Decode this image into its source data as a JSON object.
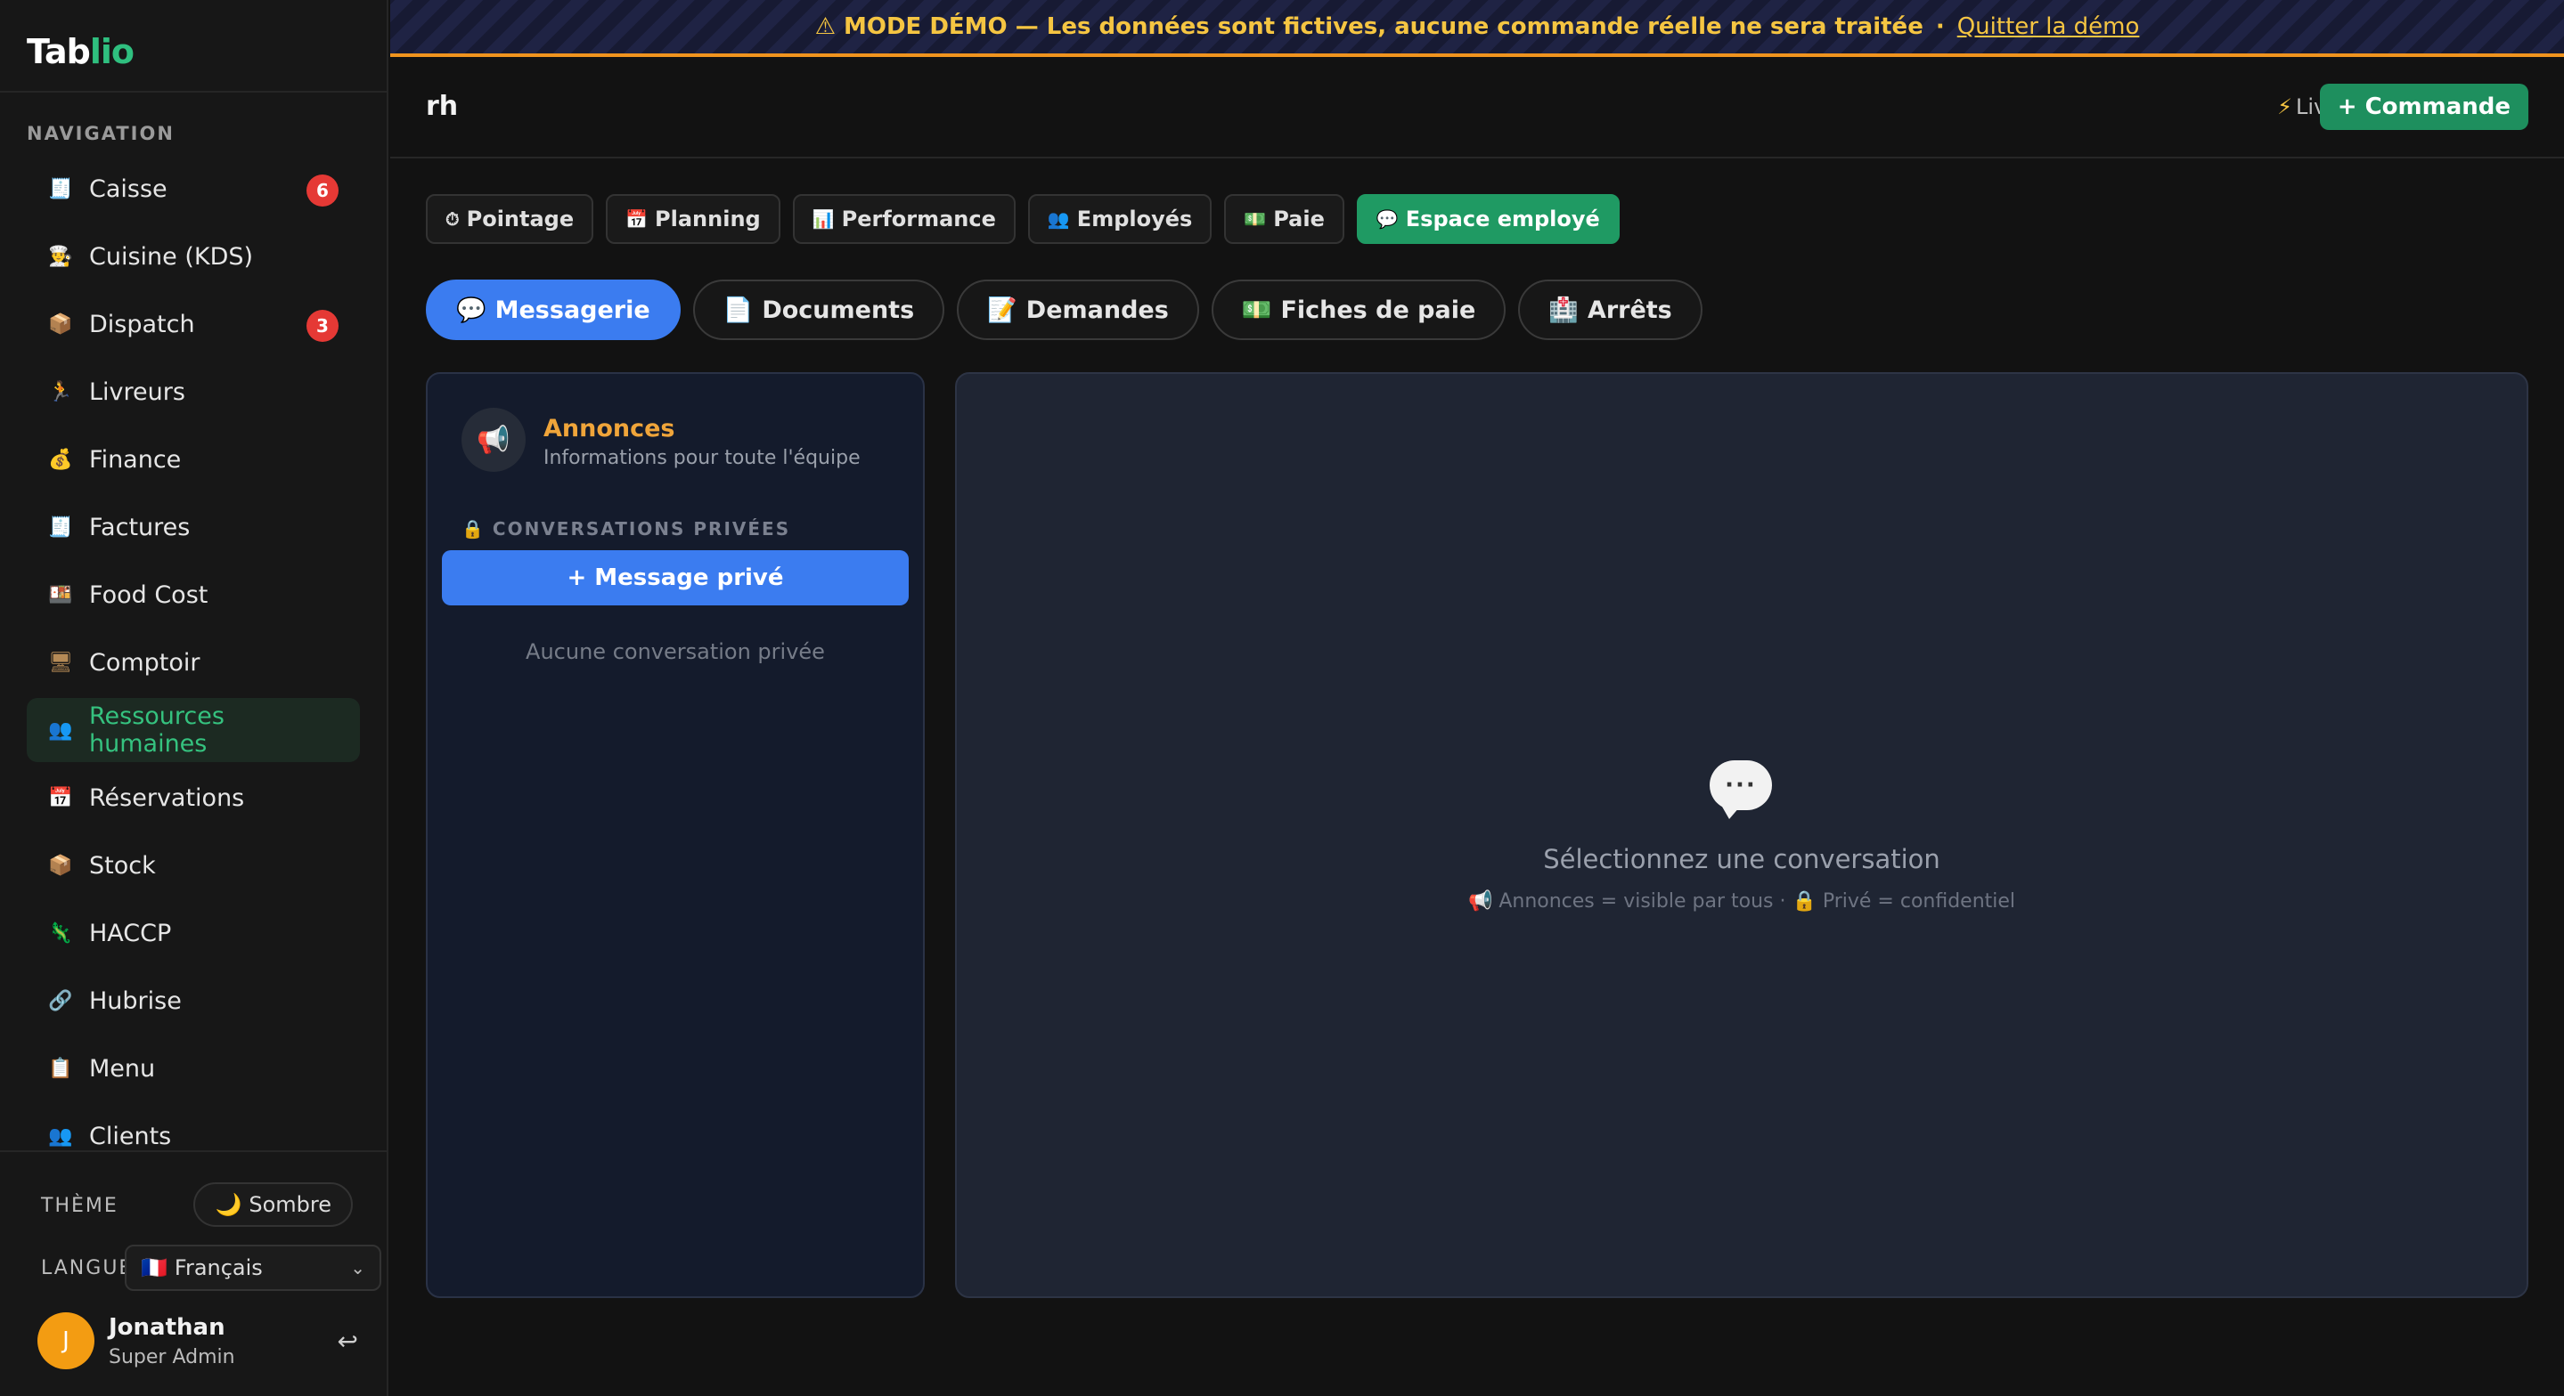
{
  "sidebar": {
    "logo": {
      "main": "Tab",
      "accent": "lio"
    },
    "nav_heading": "NAVIGATION",
    "items": [
      {
        "label": "Caisse",
        "icon": "🧾",
        "badge": "6"
      },
      {
        "label": "Cuisine (KDS)",
        "icon": "👨‍🍳"
      },
      {
        "label": "Dispatch",
        "icon": "📦",
        "badge": "3"
      },
      {
        "label": "Livreurs",
        "icon": "🏃"
      },
      {
        "label": "Finance",
        "icon": "💰"
      },
      {
        "label": "Factures",
        "icon": "🧾"
      },
      {
        "label": "Food Cost",
        "icon": "🍱"
      },
      {
        "label": "Comptoir",
        "icon": "🖥"
      },
      {
        "label": "Ressources humaines",
        "icon": "👥",
        "active": true
      },
      {
        "label": "Réservations",
        "icon": "📅"
      },
      {
        "label": "Stock",
        "icon": "📦"
      },
      {
        "label": "HACCP",
        "icon": "🦎"
      },
      {
        "label": "Hubrise",
        "icon": "🔗"
      },
      {
        "label": "Menu",
        "icon": "📋"
      },
      {
        "label": "Clients",
        "icon": "👥"
      }
    ],
    "footer": {
      "theme_label": "THÈME",
      "theme_value": "Sombre",
      "theme_icon": "🌙",
      "lang_label": "LANGUE",
      "lang_value": "Français",
      "lang_flag": "🇫🇷",
      "user_initial": "J",
      "user_name": "Jonathan",
      "user_role": "Super Admin"
    }
  },
  "banner": {
    "text": "⚠ MODE DÉMO — Les données sont fictives, aucune commande réelle ne sera traitée",
    "separator": "·",
    "quit_link": "Quitter la démo"
  },
  "header": {
    "title": "rh",
    "live_label": "Live",
    "command_button": "+ Commande"
  },
  "rh_tabs": [
    {
      "label": "Pointage",
      "icon": "⏱"
    },
    {
      "label": "Planning",
      "icon": "📅"
    },
    {
      "label": "Performance",
      "icon": "📊"
    },
    {
      "label": "Employés",
      "icon": "👥"
    },
    {
      "label": "Paie",
      "icon": "💵"
    },
    {
      "label": "Espace employé",
      "icon": "💬",
      "active": true
    }
  ],
  "sub_tabs": [
    {
      "label": "Messagerie",
      "icon": "💬",
      "active": true
    },
    {
      "label": "Documents",
      "icon": "📄"
    },
    {
      "label": "Demandes",
      "icon": "📝"
    },
    {
      "label": "Fiches de paie",
      "icon": "💵"
    },
    {
      "label": "Arrêts",
      "icon": "🏥"
    }
  ],
  "messaging": {
    "announcements_title": "Annonces",
    "announcements_sub": "Informations pour toute l'équipe",
    "private_label": "CONVERSATIONS PRIVÉES",
    "private_button": "+ Message privé",
    "empty_private": "Aucune conversation privée",
    "select_title": "Sélectionnez une conversation",
    "select_hint": "📢 Annonces = visible par tous · 🔒 Privé = confidentiel"
  },
  "colors": {
    "accent_green": "#1f9a63",
    "accent_blue": "#3b7cf0",
    "badge_red": "#e53935",
    "banner_yellow": "#f5c542",
    "announcement_orange": "#f0a53a"
  }
}
